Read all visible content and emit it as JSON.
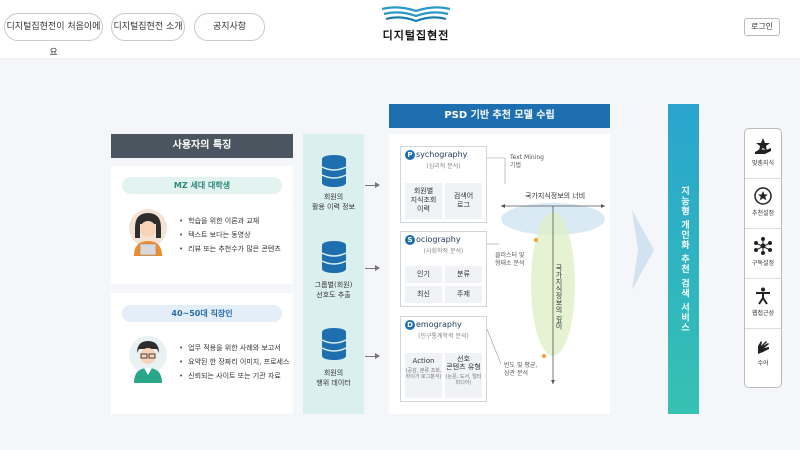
{
  "header": {
    "nav": [
      "디지털집현전이 처음이에요",
      "디지털집현전 소개",
      "공지사항"
    ],
    "logo_text": "디지털집현전",
    "login": "로그인"
  },
  "user_features": {
    "title": "사용자의 특징",
    "personas": [
      {
        "title": "MZ 세대 대학생",
        "bullets": [
          "학습을 위한 이론과 교재",
          "텍스트 보다는 동영상",
          "리뷰 또는 추천수가 많은 콘텐츠"
        ]
      },
      {
        "title": "40~50대 직장인",
        "bullets": [
          "업무 적용을 위한 사례와 보고서",
          "요약된 한 장짜리 이미지, 프로세스",
          "신뢰되는 사이트 또는 기관 자료"
        ]
      }
    ]
  },
  "data_sources": [
    {
      "label": "회원의\n활용 이력 정보"
    },
    {
      "label": "그룹별(회원)\n선호도 추출"
    },
    {
      "label": "회원의\n행위 데이터"
    }
  ],
  "psd": {
    "title": "PSD 기반 추천 모델 수립",
    "boxes": [
      {
        "letter": "P",
        "rest": "sychography",
        "sub": "(심리적 분석)",
        "cells": [
          {
            "main": "회원별\n지식조회\n이력"
          },
          {
            "main": "검색어\n로그"
          }
        ]
      },
      {
        "letter": "S",
        "rest": "ociography",
        "sub": "(사회학적 분석)",
        "cells": [
          {
            "main": "인기"
          },
          {
            "main": "분류"
          },
          {
            "main": "최신"
          },
          {
            "main": "주제"
          }
        ]
      },
      {
        "letter": "D",
        "rest": "emography",
        "sub": "(인구통계학적 분석)",
        "cells": [
          {
            "main": "Action",
            "small": "(공감, 분류 조회, 하이거 로그분석)"
          },
          {
            "main": "선호\n콘텐츠 유형",
            "small": "(논문, 도서, 멀티미디어)"
          }
        ]
      }
    ],
    "notes": [
      "Text Mining\n기법",
      "클러스터 및\n형태소 분석",
      "빈도 및 평균,\n상관 분석"
    ],
    "axis_h": "국가지식정보의 너비",
    "axis_v": "국가지식정보의 깊이"
  },
  "service": {
    "label": "지능형 개인화 추천 검색 서비스"
  },
  "quick_menu": [
    {
      "label": "맞춤지식",
      "icon": "hand-star-icon"
    },
    {
      "label": "추천설정",
      "icon": "star-circle-icon"
    },
    {
      "label": "구독설정",
      "icon": "network-icon"
    },
    {
      "label": "웹접근성",
      "icon": "accessibility-icon"
    },
    {
      "label": "수어",
      "icon": "sign-language-icon"
    }
  ],
  "colors": {
    "psd_header": "#1d6fb0",
    "left_header": "#4a5560",
    "service_gradient": [
      "#2aa4cf",
      "#35c2b2"
    ]
  }
}
